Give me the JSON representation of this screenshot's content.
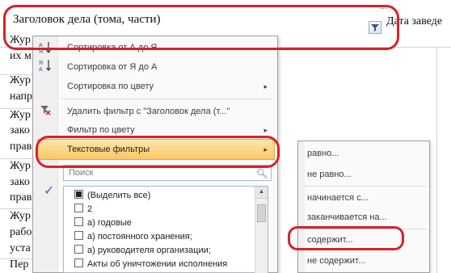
{
  "header": {
    "top_right_fragment": "...",
    "title": "Заголовок дела (тома, части)",
    "right_label": "Дата заведе"
  },
  "rows": [
    "Жур",
    "их м",
    "Жур",
    "напр",
    "Жур",
    "зако",
    "прав",
    "Жур",
    "зако",
    "прав",
    "Жур",
    "рабо",
    "уста",
    "Пер"
  ],
  "menu": {
    "items": [
      {
        "icon": "sort-asc-icon",
        "label": "Сортировка от А до Я",
        "arrow": ""
      },
      {
        "icon": "sort-desc-icon",
        "label": "Сортировка от Я до А",
        "arrow": ""
      },
      {
        "icon": "",
        "label": "Сортировка по цвету",
        "arrow": "▸"
      },
      {
        "icon": "clear-filter-icon",
        "label": "Удалить фильтр с \"Заголовок дела (т...\"",
        "arrow": ""
      },
      {
        "icon": "",
        "label": "Фильтр по цвету",
        "arrow": "▸"
      },
      {
        "icon": "",
        "label": "Текстовые фильтры",
        "arrow": "▸"
      }
    ],
    "search_placeholder": "Поиск",
    "list": [
      {
        "checked": "mixed",
        "label": "(Выделить все)"
      },
      {
        "checked": "none",
        "label": "2"
      },
      {
        "checked": "none",
        "label": "а) годовые"
      },
      {
        "checked": "none",
        "label": "а) постоянного хранения;"
      },
      {
        "checked": "none",
        "label": "а) руководителя организации;"
      },
      {
        "checked": "none",
        "label": "Акты об уничтожении исполнения"
      }
    ]
  },
  "submenu": {
    "items": [
      "равно...",
      "не равно...",
      "начинается с...",
      "заканчивается на...",
      "содержит...",
      "не содержит..."
    ]
  },
  "colors": {
    "accent_highlight": "#f8c866",
    "annotation_red": "#d8212b",
    "checkbox_blue": "#2c6cc0"
  }
}
